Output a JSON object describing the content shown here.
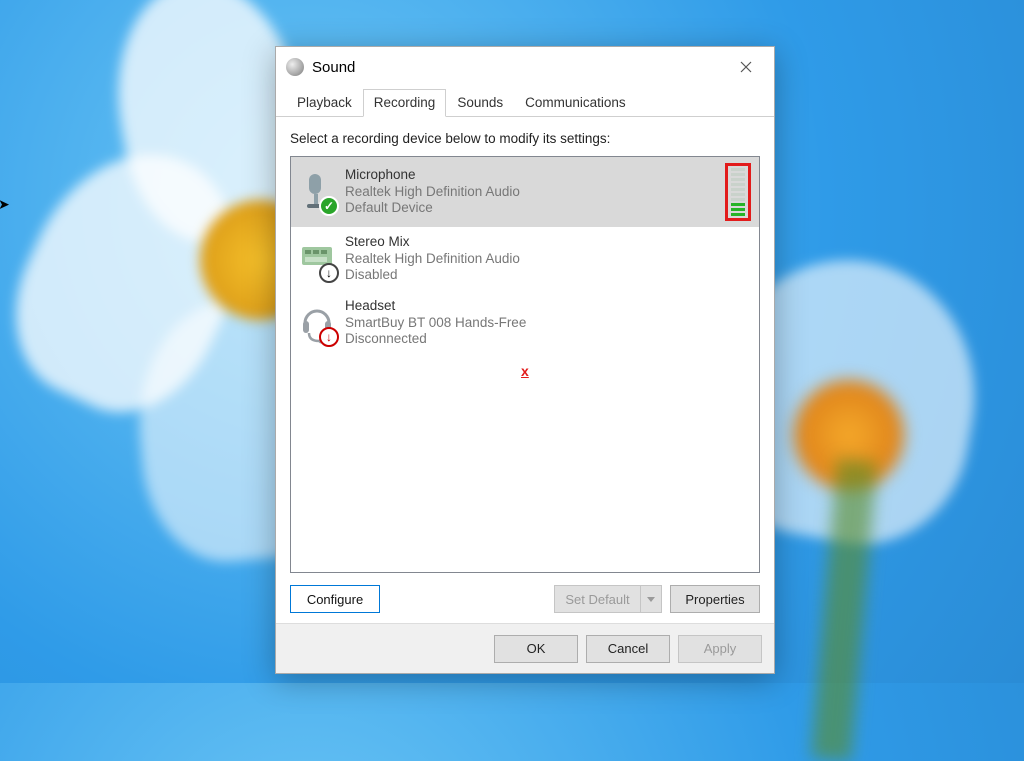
{
  "dialog": {
    "title": "Sound",
    "tabs": [
      "Playback",
      "Recording",
      "Sounds",
      "Communications"
    ],
    "active_tab_index": 1,
    "instruction": "Select a recording device below to modify its settings:",
    "devices": [
      {
        "name": "Microphone",
        "driver": "Realtek High Definition Audio",
        "status": "Default Device",
        "badge": "ok",
        "selected": true,
        "level_bars_total": 10,
        "level_bars_active": 3
      },
      {
        "name": "Stereo Mix",
        "driver": "Realtek High Definition Audio",
        "status": "Disabled",
        "badge": "down",
        "selected": false
      },
      {
        "name": "Headset",
        "driver": "SmartBuy BT 008 Hands-Free",
        "status": "Disconnected",
        "badge": "err",
        "selected": false
      }
    ],
    "buttons": {
      "configure": "Configure",
      "set_default": "Set Default",
      "properties": "Properties",
      "ok": "OK",
      "cancel": "Cancel",
      "apply": "Apply"
    },
    "annotation_x": "x"
  }
}
